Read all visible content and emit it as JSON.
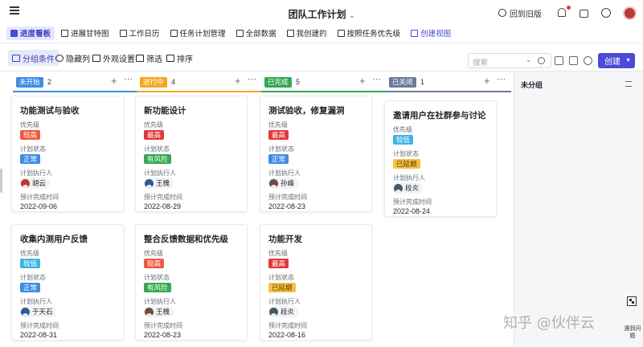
{
  "app": {
    "title": "团队工作计划",
    "back_old": "回到旧版"
  },
  "tabs": [
    {
      "label": "进度看板",
      "active": true
    },
    {
      "label": "进展甘特图"
    },
    {
      "label": "工作日历"
    },
    {
      "label": "任务计划管理"
    },
    {
      "label": "全部数据"
    },
    {
      "label": "我创建的"
    },
    {
      "label": "按照任务优先级"
    },
    {
      "label": "创建视图"
    }
  ],
  "toolbar": {
    "group": "分组条件",
    "hide": "隐藏列",
    "appearance": "外观设置",
    "filter": "筛选",
    "sort": "排序",
    "search_placeholder": "搜索",
    "create": "创建"
  },
  "labels": {
    "priority": "优先级",
    "plan_status": "计划状态",
    "assignee": "计划执行人",
    "due": "预计完成时间"
  },
  "columns": [
    {
      "status": "未开始",
      "count": "2",
      "color": "#3d8de6",
      "cards": [
        {
          "title": "功能测试与验收",
          "priority": "较高",
          "plan_status": "正常",
          "assignee": "胡云",
          "due": "2022-09-06"
        },
        {
          "title": "收集内测用户反馈",
          "priority": "较低",
          "plan_status": "正常",
          "assignee": "于天石",
          "due": "2022-08-31"
        }
      ]
    },
    {
      "status": "进行中",
      "count": "4",
      "color": "#f6a623",
      "cards": [
        {
          "title": "新功能设计",
          "priority": "最高",
          "plan_status": "有风险",
          "assignee": "王槐",
          "due": "2022-08-29"
        },
        {
          "title": "整合反馈数据和优先级",
          "priority": "较高",
          "plan_status": "有风险",
          "assignee": "王槐",
          "due": "2022-08-23"
        }
      ]
    },
    {
      "status": "已完成",
      "count": "5",
      "color": "#34a853",
      "cards": [
        {
          "title": "测试验收，修复漏洞",
          "priority": "最高",
          "plan_status": "正常",
          "assignee": "孙峰",
          "due": "2022-08-23"
        },
        {
          "title": "功能开发",
          "priority": "最高",
          "plan_status": "已延期",
          "assignee": "段炎",
          "due": "2022-08-16"
        }
      ]
    },
    {
      "status": "已关闭",
      "count": "1",
      "color": "#6b7a99",
      "cards": [
        {
          "title": "邀请用户在社群参与讨论",
          "priority": "较低",
          "plan_status": "已延期",
          "assignee": "段炎",
          "due": "2022-08-24"
        }
      ]
    }
  ],
  "unassigned": {
    "title": "未分组"
  },
  "overlay": {
    "watermark": "知乎 @伙伴云",
    "side_label": "遇到问题"
  }
}
